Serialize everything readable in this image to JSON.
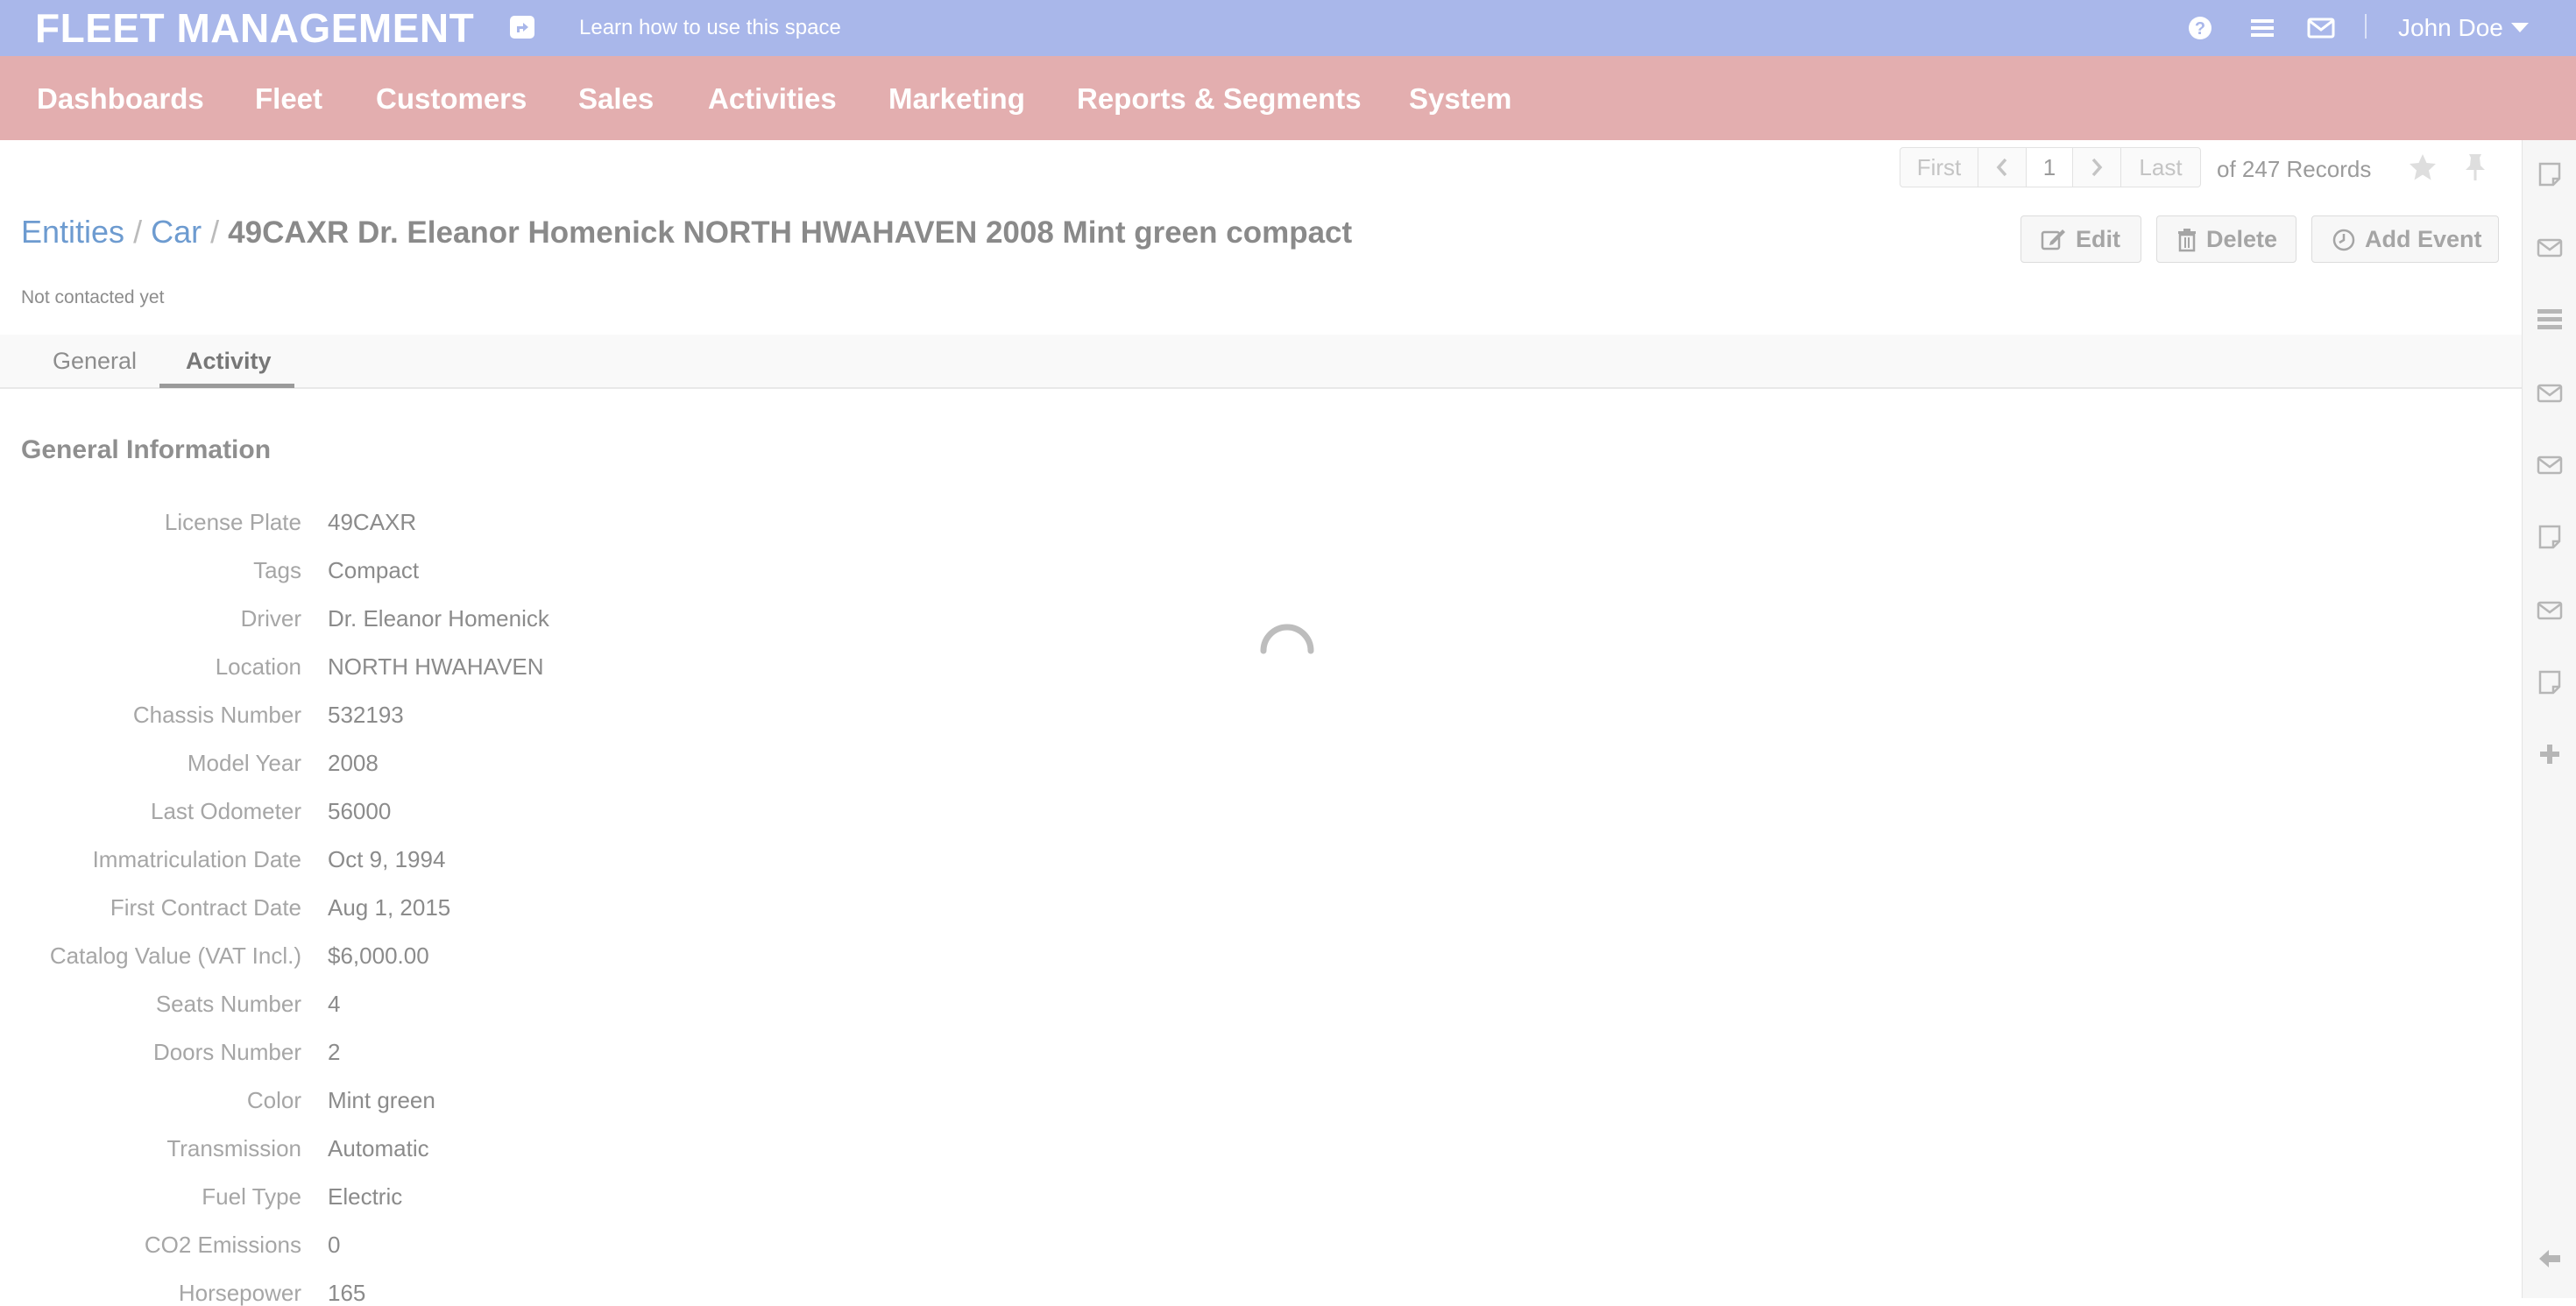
{
  "header": {
    "brand": "FLEET MANAGEMENT",
    "learn_link": "Learn how to use this space",
    "icons": [
      "help-icon",
      "menu-icon",
      "mail-icon"
    ],
    "user_name": "John Doe"
  },
  "nav": {
    "items": [
      "Dashboards",
      "Fleet",
      "Customers",
      "Sales",
      "Activities",
      "Marketing",
      "Reports & Segments",
      "System"
    ]
  },
  "pager": {
    "first": "First",
    "page": "1",
    "last": "Last",
    "records": "of 247 Records"
  },
  "breadcrumb": {
    "root": "Entities",
    "separator": "/",
    "entity": "Car",
    "title": "49CAXR Dr. Eleanor Homenick NORTH HWAHAVEN 2008 Mint green compact"
  },
  "actions": {
    "edit": "Edit",
    "delete": "Delete",
    "add_event": "Add Event"
  },
  "status_line": "Not contacted yet",
  "tabs": [
    {
      "label": "General",
      "active": false
    },
    {
      "label": "Activity",
      "active": true
    }
  ],
  "section": {
    "title": "General Information",
    "fields": [
      {
        "label": "License Plate",
        "value": "49CAXR"
      },
      {
        "label": "Tags",
        "value": "Compact"
      },
      {
        "label": "Driver",
        "value": "Dr. Eleanor Homenick"
      },
      {
        "label": "Location",
        "value": "NORTH HWAHAVEN"
      },
      {
        "label": "Chassis Number",
        "value": "532193"
      },
      {
        "label": "Model Year",
        "value": "2008"
      },
      {
        "label": "Last Odometer",
        "value": "56000"
      },
      {
        "label": "Immatriculation Date",
        "value": "Oct 9, 1994"
      },
      {
        "label": "First Contract Date",
        "value": "Aug 1, 2015"
      },
      {
        "label": "Catalog Value (VAT Incl.)",
        "value": "$6,000.00"
      },
      {
        "label": "Seats Number",
        "value": "4"
      },
      {
        "label": "Doors Number",
        "value": "2"
      },
      {
        "label": "Color",
        "value": "Mint green"
      },
      {
        "label": "Transmission",
        "value": "Automatic"
      },
      {
        "label": "Fuel Type",
        "value": "Electric"
      },
      {
        "label": "CO2 Emissions",
        "value": "0"
      },
      {
        "label": "Horsepower",
        "value": "165"
      }
    ]
  },
  "sidebar_icons": [
    "note-icon",
    "mail-icon",
    "list-icon",
    "mail-icon",
    "mail-icon",
    "note-icon",
    "mail-icon",
    "note-icon",
    "plus-icon",
    "arrow-left-icon"
  ],
  "colors": {
    "header_bg": "#a9b7ea",
    "nav_bg": "#e3aeaf",
    "link": "#6d9bd0"
  }
}
